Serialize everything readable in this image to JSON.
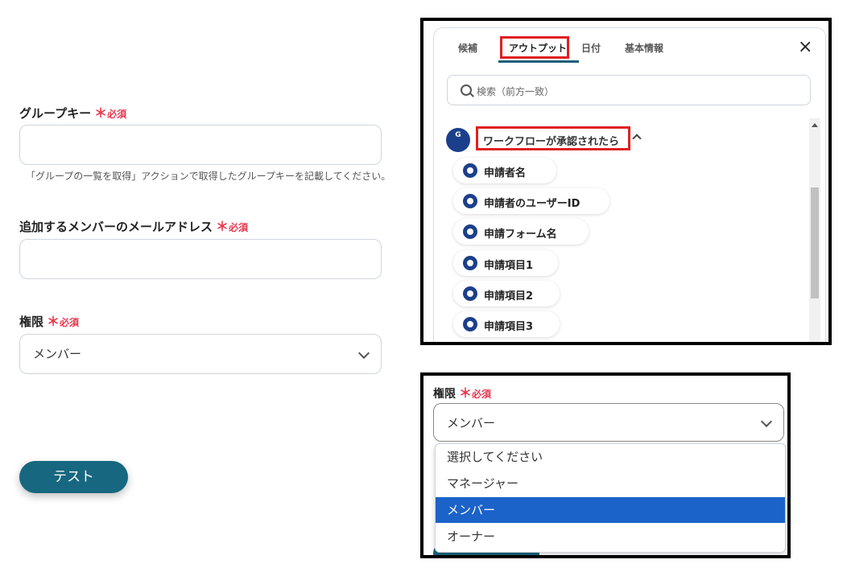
{
  "form": {
    "group_key": {
      "label": "グループキー",
      "req_mark": "＊",
      "req_text": "必須",
      "value": ""
    },
    "group_key_help": "「グループの一覧を取得」アクションで取得したグループキーを記載してください。",
    "member_email": {
      "label": "追加するメンバーのメールアドレス",
      "req_mark": "＊",
      "req_text": "必須",
      "value": ""
    },
    "role": {
      "label": "権限",
      "req_mark": "＊",
      "req_text": "必須",
      "value": "メンバー"
    },
    "test_button": "テスト"
  },
  "output_panel": {
    "tabs": [
      {
        "label": "候補",
        "active": false
      },
      {
        "label": "アウトプット",
        "active": true
      },
      {
        "label": "日付",
        "active": false
      },
      {
        "label": "基本情報",
        "active": false
      }
    ],
    "close_icon": "×",
    "search_placeholder": "検索（前方一致）",
    "group_title": "ワークフローが承認されたら",
    "items": [
      "申請者名",
      "申請者のユーザーID",
      "申請フォーム名",
      "申請項目1",
      "申請項目2",
      "申請項目3"
    ]
  },
  "role_dropdown": {
    "label": "権限",
    "req_mark": "＊",
    "req_text": "必須",
    "value": "メンバー",
    "options": [
      "選択してください",
      "マネージャー",
      "メンバー",
      "オーナー"
    ],
    "selected_index": 2,
    "highlight_color": "#1b63c9"
  },
  "colors": {
    "accent": "#16677f",
    "required": "#e8384f",
    "annotation_border": "#e02020"
  }
}
